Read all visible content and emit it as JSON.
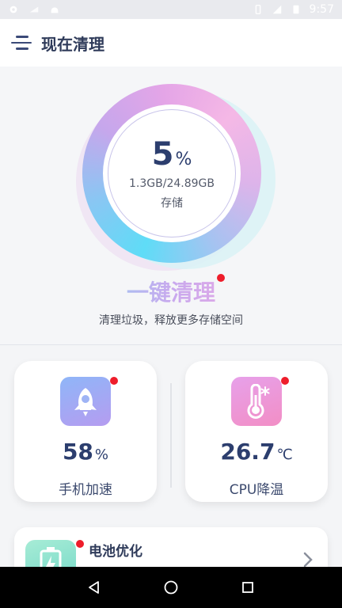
{
  "status_bar": {
    "time": "9:57",
    "icons_left": [
      "settings-icon",
      "signal-icon",
      "android-icon"
    ],
    "icons_right": [
      "vibrate-icon",
      "mobile-signal-icon",
      "battery-icon"
    ]
  },
  "app_bar": {
    "title": "现在清理",
    "menu_icon": "menu-icon"
  },
  "storage": {
    "percent": "5",
    "percent_unit": "%",
    "detail": "1.3GB/24.89GB",
    "label": "存储"
  },
  "clean": {
    "title": "一键清理",
    "subtitle": "清理垃圾，释放更多存储空间"
  },
  "cards": {
    "speed": {
      "value": "58",
      "unit": "%",
      "label": "手机加速",
      "icon": "rocket-icon"
    },
    "cpu": {
      "value": "26.7",
      "unit": "℃",
      "label": "CPU降温",
      "icon": "thermometer-icon"
    }
  },
  "battery": {
    "title": "电池优化",
    "icon": "battery-charge-icon"
  },
  "colors": {
    "accent_dark": "#2c3e6e",
    "badge_red": "#ee1d2b",
    "ring_cyan": "#5fdcf7",
    "ring_pink": "#f5b8e6"
  }
}
